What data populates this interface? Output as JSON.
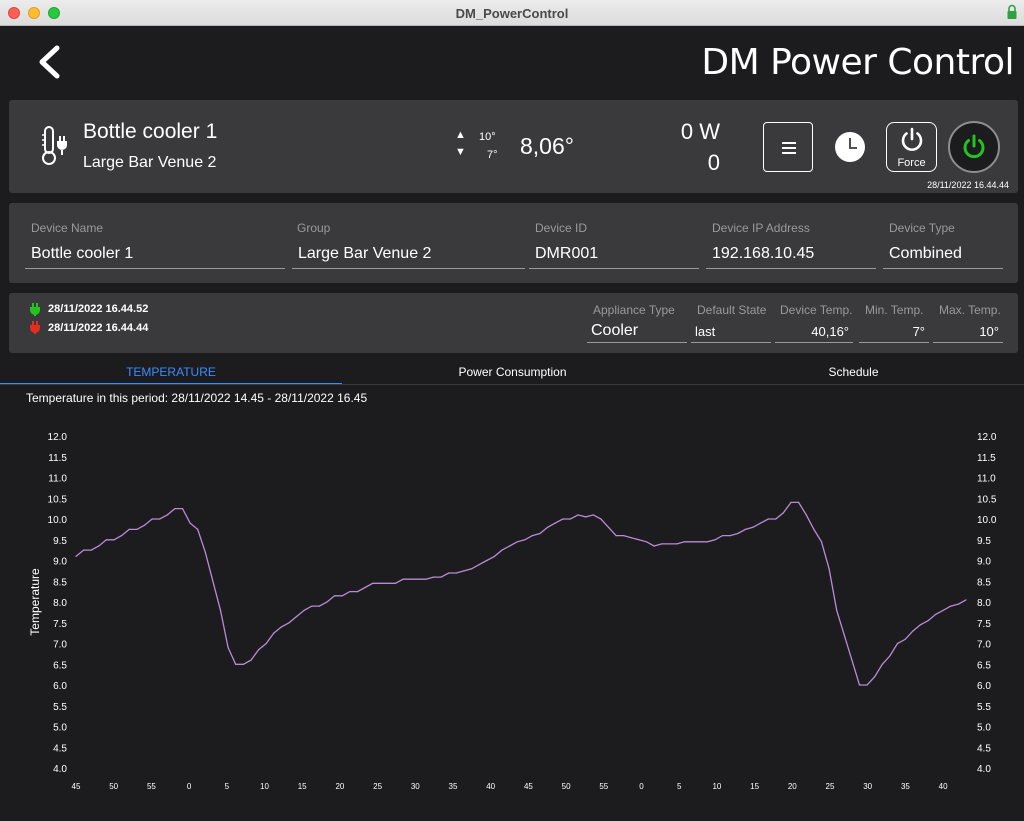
{
  "window": {
    "title": "DM_PowerControl"
  },
  "header": {
    "title": "DM Power Control"
  },
  "device": {
    "name": "Bottle cooler 1",
    "group": "Large Bar Venue 2",
    "temp_max": "10°",
    "temp_min": "7°",
    "current_temp": "8,06°",
    "power": "0 W",
    "power_count": "0",
    "force_label": "Force",
    "timestamp": "28/11/2022 16.44.44"
  },
  "fields": [
    {
      "label": "Device Name",
      "value": "Bottle cooler 1"
    },
    {
      "label": "Group",
      "value": "Large Bar Venue 2"
    },
    {
      "label": "Device ID",
      "value": "DMR001"
    },
    {
      "label": "Device IP Address",
      "value": "192.168.10.45"
    },
    {
      "label": "Device Type",
      "value": "Combined"
    }
  ],
  "status": {
    "on_time": "28/11/2022 16.44.52",
    "off_time": "28/11/2022 16.44.44",
    "appliance_type_label": "Appliance Type",
    "appliance_type": "Cooler",
    "default_state_label": "Default State",
    "default_state": "last",
    "device_temp_label": "Device Temp.",
    "device_temp": "40,16°",
    "min_temp_label": "Min. Temp.",
    "min_temp": "7°",
    "max_temp_label": "Max. Temp.",
    "max_temp": "10°"
  },
  "tabs": [
    {
      "label": "TEMPERATURE",
      "active": true
    },
    {
      "label": "Power Consumption",
      "active": false
    },
    {
      "label": "Schedule",
      "active": false
    }
  ],
  "period_text": "Temperature in this period: 28/11/2022 14.45 - 28/11/2022 16.45",
  "colors": {
    "accent": "#3a8dfe",
    "line": "#b98ad6",
    "on": "#22c41f",
    "off": "#e52d1d"
  },
  "chart_data": {
    "type": "line",
    "ylabel": "Temperature",
    "ylim": [
      4.0,
      12.0
    ],
    "yticks": [
      "12.0",
      "11.5",
      "11.0",
      "10.5",
      "10.0",
      "9.5",
      "9.0",
      "8.5",
      "8.0",
      "7.5",
      "7.0",
      "6.5",
      "6.0",
      "5.5",
      "5.0",
      "4.5",
      "4.0"
    ],
    "xticks": [
      "45",
      "50",
      "55",
      "0",
      "5",
      "10",
      "15",
      "20",
      "25",
      "30",
      "35",
      "40",
      "45",
      "50",
      "55",
      "0",
      "5",
      "10",
      "15",
      "20",
      "25",
      "30",
      "35",
      "40"
    ],
    "series": [
      {
        "values": [
          9.1,
          9.25,
          9.25,
          9.35,
          9.5,
          9.5,
          9.6,
          9.75,
          9.75,
          9.85,
          10.0,
          10.0,
          10.1,
          10.25,
          10.25,
          9.9,
          9.75,
          9.2,
          8.5,
          7.8,
          6.9,
          6.5,
          6.5,
          6.6,
          6.85,
          7.0,
          7.25,
          7.4,
          7.5,
          7.65,
          7.8,
          7.9,
          7.9,
          8.0,
          8.15,
          8.15,
          8.25,
          8.25,
          8.35,
          8.45,
          8.45,
          8.45,
          8.45,
          8.55,
          8.55,
          8.55,
          8.55,
          8.6,
          8.6,
          8.7,
          8.7,
          8.75,
          8.8,
          8.9,
          9.0,
          9.1,
          9.25,
          9.35,
          9.45,
          9.5,
          9.6,
          9.65,
          9.8,
          9.9,
          10.0,
          10.0,
          10.1,
          10.05,
          10.1,
          10.0,
          9.8,
          9.6,
          9.6,
          9.55,
          9.5,
          9.45,
          9.35,
          9.4,
          9.4,
          9.4,
          9.45,
          9.45,
          9.45,
          9.45,
          9.5,
          9.6,
          9.6,
          9.65,
          9.75,
          9.8,
          9.9,
          10.0,
          10.0,
          10.15,
          10.4,
          10.4,
          10.1,
          9.75,
          9.45,
          8.8,
          7.8,
          7.2,
          6.6,
          6.0,
          6.0,
          6.2,
          6.5,
          6.7,
          7.0,
          7.1,
          7.3,
          7.45,
          7.55,
          7.7,
          7.8,
          7.9,
          7.95,
          8.05
        ]
      }
    ]
  }
}
